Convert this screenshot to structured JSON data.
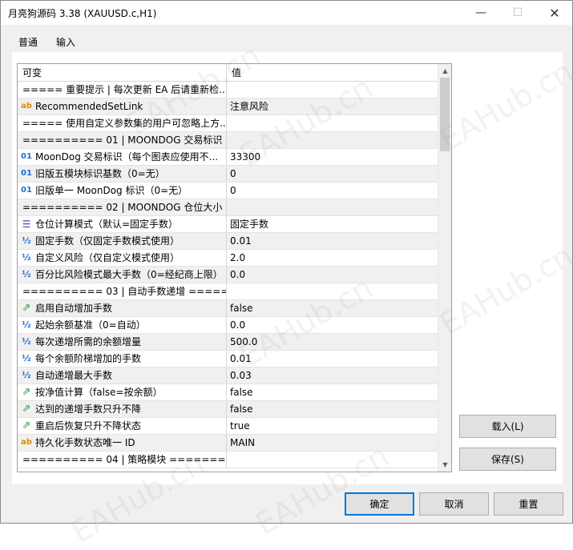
{
  "window": {
    "title": "月亮狗源码 3.38 (XAUUSD.c,H1)",
    "minimize_icon": "minimize-icon",
    "maximize_icon": "maximize-icon",
    "close_icon": "close-icon"
  },
  "tabs": [
    {
      "label": "普通",
      "selected": false
    },
    {
      "label": "输入",
      "selected": true
    }
  ],
  "grid": {
    "columns": [
      "可变",
      "值"
    ],
    "rows": [
      {
        "icon": "",
        "variable": "===== 重要提示 | 每次更新 EA 后请重新检...",
        "value": "",
        "section": true
      },
      {
        "icon": "ab",
        "variable": "RecommendedSetLink",
        "value": "注意风险"
      },
      {
        "icon": "",
        "variable": "===== 使用自定义参数集的用户可忽略上方...",
        "value": "",
        "section": true
      },
      {
        "icon": "",
        "variable": "========== 01 | MOONDOG 交易标识 ...",
        "value": "",
        "section": true
      },
      {
        "icon": "01",
        "variable": "MoonDog 交易标识（每个图表应使用不...",
        "value": "33300"
      },
      {
        "icon": "01",
        "variable": "旧版五模块标识基数（0=无）",
        "value": "0"
      },
      {
        "icon": "01",
        "variable": "旧版单一 MoonDog 标识（0=无）",
        "value": "0"
      },
      {
        "icon": "",
        "variable": "========== 02 | MOONDOG 仓位大小 ...",
        "value": "",
        "section": true
      },
      {
        "icon": "list",
        "variable": "仓位计算模式（默认=固定手数）",
        "value": "固定手数"
      },
      {
        "icon": "½",
        "variable": "固定手数（仅固定手数模式使用）",
        "value": "0.01"
      },
      {
        "icon": "½",
        "variable": "自定义风险（仅自定义模式使用）",
        "value": "2.0"
      },
      {
        "icon": "½",
        "variable": "百分比风险模式最大手数（0=经纪商上限）",
        "value": "0.0"
      },
      {
        "icon": "",
        "variable": "========== 03 | 自动手数递增 =====...",
        "value": "",
        "section": true
      },
      {
        "icon": "arrow",
        "variable": "启用自动增加手数",
        "value": "false"
      },
      {
        "icon": "½",
        "variable": "起始余额基准（0=自动）",
        "value": "0.0"
      },
      {
        "icon": "½",
        "variable": "每次递增所需的余额增量",
        "value": "500.0"
      },
      {
        "icon": "½",
        "variable": "每个余额阶梯增加的手数",
        "value": "0.01"
      },
      {
        "icon": "½",
        "variable": "自动递增最大手数",
        "value": "0.03"
      },
      {
        "icon": "arrow",
        "variable": "按净值计算（false=按余额）",
        "value": "false"
      },
      {
        "icon": "arrow",
        "variable": "达到的递增手数只升不降",
        "value": "false"
      },
      {
        "icon": "arrow",
        "variable": "重启后恢复只升不降状态",
        "value": "true"
      },
      {
        "icon": "ab",
        "variable": "持久化手数状态唯一 ID",
        "value": "MAIN"
      },
      {
        "icon": "",
        "variable": "========== 04 | 策略模块 ==========...",
        "value": "",
        "section": true
      }
    ]
  },
  "buttons": {
    "load": "载入(L)",
    "save": "保存(S)",
    "ok": "确定",
    "cancel": "取消",
    "reset": "重置"
  },
  "watermark": "EAHub.cn"
}
